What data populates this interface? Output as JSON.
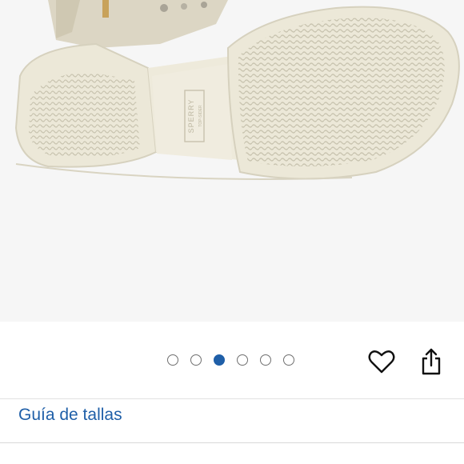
{
  "product_image": {
    "brand_stamp_line1": "SPERRY",
    "brand_stamp_line2": "TOP-SIDER",
    "colors": {
      "background": "#f6f6f6",
      "sole": "#ece8d8",
      "sole_shadow": "#d6d1be",
      "upper": "#dcd6c4",
      "tread": "#c7c2ae"
    }
  },
  "gallery": {
    "image_count": 6,
    "active_index": 2,
    "accent_color": "#1f5fa8"
  },
  "actions": {
    "favorite_icon": "heart-icon",
    "share_icon": "share-icon"
  },
  "size_guide": {
    "label": "Guía de tallas"
  }
}
